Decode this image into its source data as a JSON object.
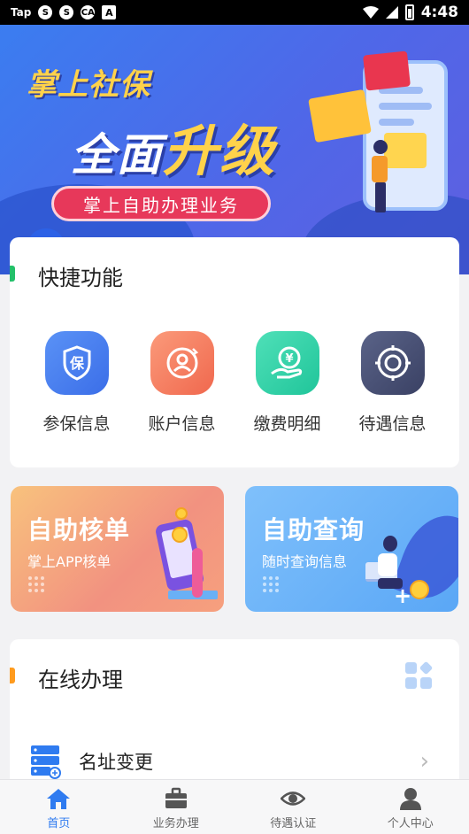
{
  "status_bar": {
    "carrier": "Tap",
    "icon1": "S",
    "icon2": "S",
    "icon3": "CA",
    "icon4": "A",
    "time": "4:48"
  },
  "banner": {
    "title_line1": "掌上社保",
    "title_line2a": "全面",
    "title_line2b": "升级",
    "pill": "掌上自助办理业务"
  },
  "quick": {
    "title": "快捷功能",
    "items": [
      {
        "label": "参保信息",
        "icon": "shield-bao-icon",
        "color": "#3f7df0"
      },
      {
        "label": "账户信息",
        "icon": "account-user-icon",
        "color": "#f57a5e"
      },
      {
        "label": "缴费明细",
        "icon": "payment-yuan-icon",
        "color": "#2fd3a4"
      },
      {
        "label": "待遇信息",
        "icon": "benefit-globe-icon",
        "color": "#454d72"
      }
    ]
  },
  "tiles": {
    "left": {
      "title": "自助核单",
      "sub": "掌上APP核单"
    },
    "right": {
      "title": "自助查询",
      "sub": "随时查询信息"
    }
  },
  "online": {
    "title": "在线办理",
    "items": [
      {
        "label": "名址变更",
        "icon": "address-change-icon"
      }
    ]
  },
  "nav": {
    "items": [
      {
        "label": "首页",
        "icon": "home-icon",
        "active": true
      },
      {
        "label": "业务办理",
        "icon": "briefcase-icon",
        "active": false
      },
      {
        "label": "待遇认证",
        "icon": "eye-icon",
        "active": false
      },
      {
        "label": "个人中心",
        "icon": "person-icon",
        "active": false
      }
    ]
  },
  "colors": {
    "primary": "#2f7bf0",
    "quick_accent": "#23c06a",
    "online_accent": "#ff9b1e"
  }
}
